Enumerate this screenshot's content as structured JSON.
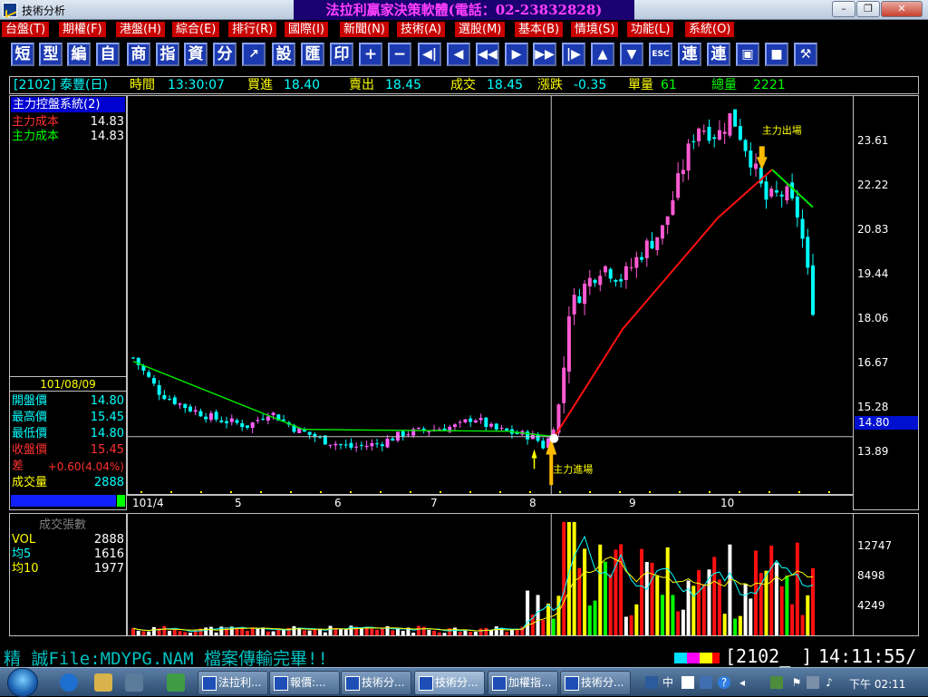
{
  "window": {
    "title": "技術分析",
    "banner": "法拉利贏家決策軟體(電話：02-23832828)"
  },
  "menu": [
    "台盤(T)",
    "期權(F)",
    "港盤(H)",
    "綜合(E)",
    "排行(R)",
    "國際(I)",
    "新聞(N)",
    "技術(A)",
    "選股(M)",
    "基本(B)",
    "情境(S)",
    "功能(L)",
    "系統(O)"
  ],
  "toolbar": {
    "chars": [
      "短",
      "型",
      "編",
      "自",
      "商",
      "指",
      "資",
      "分"
    ],
    "chars2": [
      "設",
      "匯",
      "印"
    ],
    "chars3": [
      "連",
      "連"
    ],
    "plus": "+",
    "minus": "−",
    "arrows": [
      "◀|",
      "◀",
      "◀◀",
      "▶",
      "▶▶",
      "|▶",
      "▲",
      "▼"
    ],
    "esc": "ESC"
  },
  "quote": {
    "code_name": "[2102] 泰豐(日)",
    "time_label": "時間",
    "time": "13:30:07",
    "bid_label": "買進",
    "bid": "18.40",
    "ask_label": "賣出",
    "ask": "18.45",
    "deal_label": "成交",
    "deal": "18.45",
    "chg_label": "漲跌",
    "chg": "-0.35",
    "vol_label": "單量",
    "vol": "61",
    "total_label": "總量",
    "total": "2221"
  },
  "system": {
    "title": "主力控盤系統(2)",
    "lines": [
      {
        "label": "主力成本",
        "value": "14.83",
        "color": "#ff3030"
      },
      {
        "label": "主力成本",
        "value": "14.83",
        "color": "#00ff00"
      }
    ]
  },
  "info": {
    "date": "101/08/09",
    "rows": [
      {
        "label": "開盤價",
        "value": "14.80",
        "color": "#00ffff",
        "vcolor": "#00ffff"
      },
      {
        "label": "最高價",
        "value": "15.45",
        "color": "#00ffff",
        "vcolor": "#00ffff"
      },
      {
        "label": "最低價",
        "value": "14.80",
        "color": "#00ffff",
        "vcolor": "#00ffff"
      },
      {
        "label": "收盤價",
        "value": "15.45",
        "color": "#ff3030",
        "vcolor": "#ff3030"
      },
      {
        "label": "差",
        "value": "+0.60(4.04%)",
        "color": "#ff3030",
        "vcolor": "#ff3030"
      },
      {
        "label": "成交量",
        "value": "2888",
        "color": "#ffff00",
        "vcolor": "#00ffff"
      }
    ]
  },
  "annotations": {
    "exit": "主力出場",
    "entry": "主力進場"
  },
  "volume_panel": {
    "title": "成交張數",
    "rows": [
      {
        "label": "VOL",
        "value": "2888",
        "color": "#ffff00"
      },
      {
        "label": "均5",
        "value": "1616",
        "color": "#00ffff"
      },
      {
        "label": "均10",
        "value": "1977",
        "color": "#ffff00"
      }
    ]
  },
  "price_axis": {
    "ticks": [
      "23.61",
      "22.22",
      "20.83",
      "19.44",
      "18.06",
      "16.67",
      "15.28",
      "13.89"
    ],
    "current": "14.80"
  },
  "volume_axis": {
    "ticks": [
      "12747",
      "8498",
      "4249"
    ]
  },
  "x_axis": {
    "labels": [
      "101/4",
      "5",
      "6",
      "7",
      "8",
      "9",
      "10"
    ]
  },
  "status": {
    "message": "精 誠File:MDYPG.NAM 檔案傳輸完畢!!",
    "code": "[2102_  ]",
    "time": "14:11:55/"
  },
  "taskbar": {
    "tasks": [
      "法拉利...",
      "報價:...",
      "技術分...",
      "技術分...",
      "加權指...",
      "技術分..."
    ],
    "ime": "中",
    "clock": "下午 02:11"
  },
  "chart_data": {
    "type": "candlestick",
    "y_range": [
      13.2,
      24.3
    ],
    "volume_range": [
      0,
      15000
    ],
    "months": [
      "101/4",
      "5",
      "6",
      "7",
      "8",
      "9",
      "10"
    ],
    "anchor_closes": [
      {
        "month": "4",
        "price": 17.0
      },
      {
        "month": "5",
        "price": 15.3
      },
      {
        "month": "6",
        "price": 14.6
      },
      {
        "month": "7",
        "price": 15.1
      },
      {
        "month": "8",
        "price": 14.8
      },
      {
        "month": "8",
        "price": 18.6
      },
      {
        "month": "9",
        "price": 20.2
      },
      {
        "month": "10",
        "price": 23.2
      },
      {
        "month": "10",
        "price": 18.45
      }
    ],
    "cost_line": [
      {
        "t": 0.0,
        "price": 16.9
      },
      {
        "t": 0.25,
        "price": 15.0
      },
      {
        "t": 0.55,
        "price": 14.95
      },
      {
        "t": 0.62,
        "price": 14.8
      },
      {
        "t": 0.72,
        "price": 17.8
      },
      {
        "t": 0.86,
        "price": 20.9
      },
      {
        "t": 0.94,
        "price": 22.25
      },
      {
        "t": 1.0,
        "price": 21.2
      }
    ]
  }
}
